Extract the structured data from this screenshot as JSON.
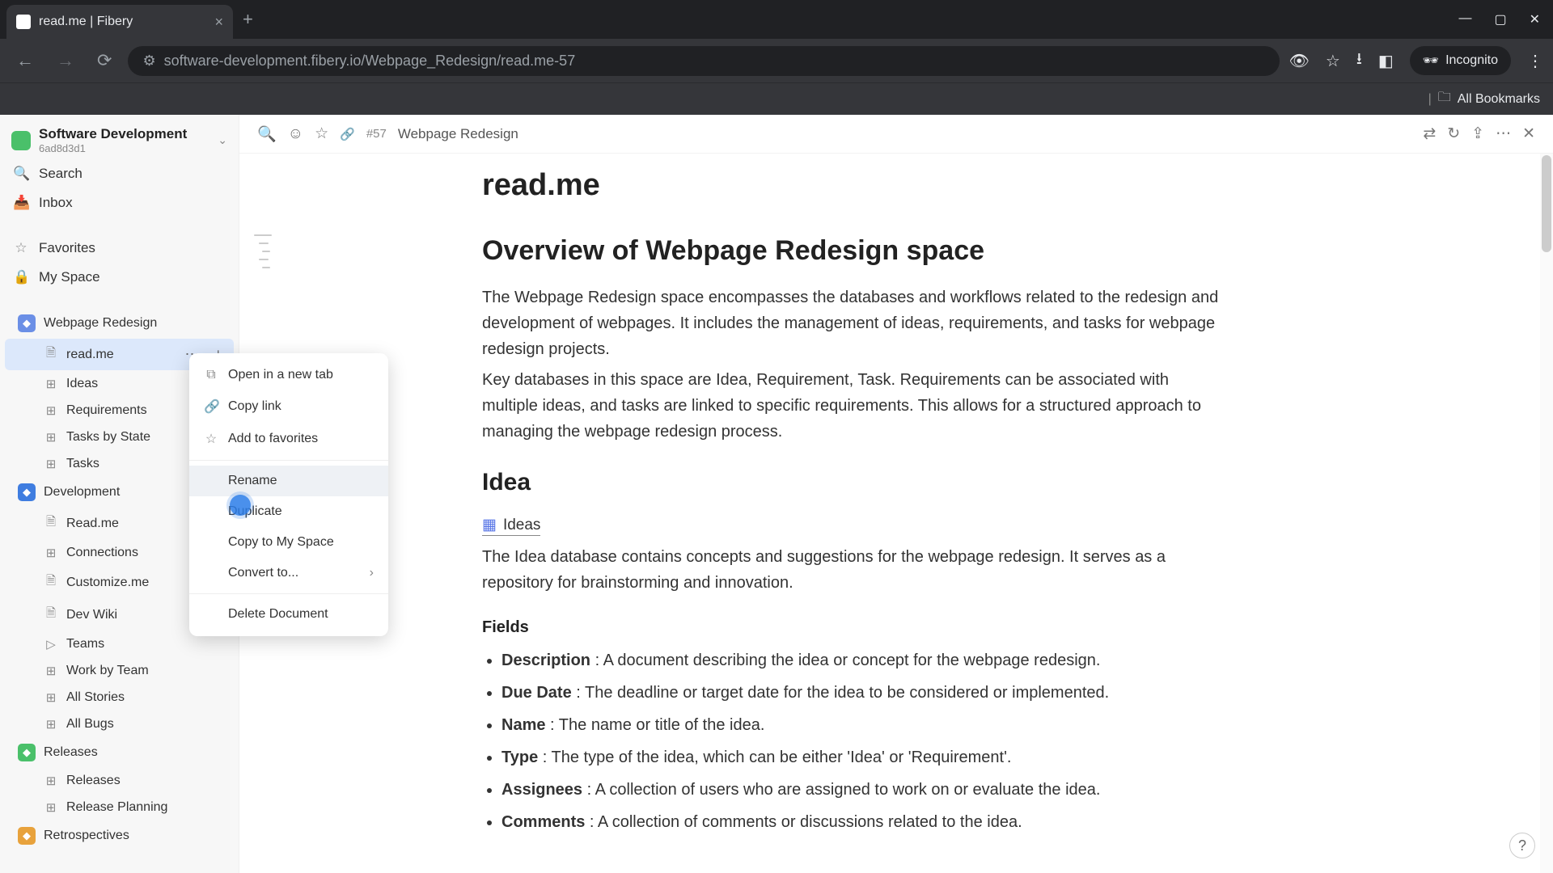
{
  "browser": {
    "tab_title": "read.me | Fibery",
    "url": "software-development.fibery.io/Webpage_Redesign/read.me-57",
    "incognito_label": "Incognito",
    "all_bookmarks": "All Bookmarks"
  },
  "workspace": {
    "name": "Software Development",
    "sub": "6ad8d3d1"
  },
  "sidebar": {
    "search": "Search",
    "inbox": "Inbox",
    "favorites": "Favorites",
    "myspace": "My Space"
  },
  "spaces": [
    {
      "name": "Webpage Redesign",
      "color": "#6b8fe6",
      "children": [
        {
          "label": "read.me",
          "icon": "doc",
          "active": true,
          "show_dots": true
        },
        {
          "label": "Ideas",
          "icon": "grid"
        },
        {
          "label": "Requirements",
          "icon": "grid"
        },
        {
          "label": "Tasks by State",
          "icon": "grid"
        },
        {
          "label": "Tasks",
          "icon": "grid"
        }
      ]
    },
    {
      "name": "Development",
      "color": "#3f7de0",
      "children": [
        {
          "label": "Read.me",
          "icon": "doc"
        },
        {
          "label": "Connections",
          "icon": "grid"
        },
        {
          "label": "Customize.me",
          "icon": "doc"
        },
        {
          "label": "Dev Wiki",
          "icon": "doc"
        },
        {
          "label": "Teams",
          "icon": "play"
        },
        {
          "label": "Work by Team",
          "icon": "grid"
        },
        {
          "label": "All Stories",
          "icon": "grid"
        },
        {
          "label": "All Bugs",
          "icon": "grid"
        }
      ]
    },
    {
      "name": "Releases",
      "color": "#4ac06a",
      "children": [
        {
          "label": "Releases",
          "icon": "grid"
        },
        {
          "label": "Release Planning",
          "icon": "grid"
        }
      ]
    },
    {
      "name": "Retrospectives",
      "color": "#e8a23c",
      "children": []
    }
  ],
  "context_menu": {
    "open_new_tab": "Open in a new tab",
    "copy_link": "Copy link",
    "add_favorites": "Add to favorites",
    "rename": "Rename",
    "duplicate": "Duplicate",
    "copy_my_space": "Copy to My Space",
    "convert_to": "Convert to...",
    "delete": "Delete Document"
  },
  "toolbar": {
    "doc_id": "#57",
    "breadcrumb": "Webpage Redesign"
  },
  "doc": {
    "title": "read.me",
    "h_overview": "Overview of Webpage Redesign space",
    "p1": "The Webpage Redesign space encompasses the databases and workflows related to the redesign and development of webpages. It includes the management of ideas, requirements, and tasks for webpage redesign projects.",
    "p2": "Key databases in this space are Idea, Requirement, Task. Requirements can be associated with multiple ideas, and tasks are linked to specific requirements. This allows for a structured approach to managing the webpage redesign process.",
    "h_idea": "Idea",
    "ideas_link": "Ideas",
    "p3": "The Idea database contains concepts and suggestions for the webpage redesign. It serves as a repository for brainstorming and innovation.",
    "h_fields": "Fields",
    "fields": [
      {
        "name": "Description",
        "desc": " : A document describing the idea or concept for the webpage redesign."
      },
      {
        "name": "Due Date",
        "desc": " : The deadline or target date for the idea to be considered or implemented."
      },
      {
        "name": "Name",
        "desc": " : The name or title of the idea."
      },
      {
        "name": "Type",
        "desc": " : The type of the idea, which can be either 'Idea' or 'Requirement'."
      },
      {
        "name": "Assignees",
        "desc": " : A collection of users who are assigned to work on or evaluate the idea."
      },
      {
        "name": "Comments",
        "desc": " : A collection of comments or discussions related to the idea."
      }
    ]
  }
}
